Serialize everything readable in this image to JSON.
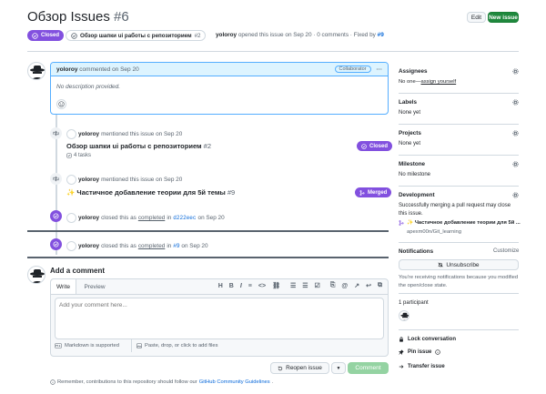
{
  "header": {
    "title": "Обзор Issues",
    "number": "#6",
    "edit_label": "Edit",
    "new_issue_label": "New issue"
  },
  "meta": {
    "status": "Closed",
    "linked_title": "Обзор шапки ui работы с репозиторием",
    "linked_number": "#2",
    "author": "yoloroy",
    "opened_text": "opened this issue on Sep 20 · 0 comments · Fixed by",
    "fixed_by": "#9"
  },
  "comment": {
    "author": "yoloroy",
    "action": "commented on Sep 20",
    "badge": "Collaborator",
    "body": "No description provided."
  },
  "timeline": {
    "mention1": {
      "author": "yoloroy",
      "action": "mentioned this issue on Sep 20",
      "title": "Обзор шапки ui работы с репозиторием",
      "number": "#2",
      "tasks": "4 tasks",
      "status": "Closed"
    },
    "mention2": {
      "author": "yoloroy",
      "action": "mentioned this issue on Sep 20",
      "title": "✨ Частичное добавление теории для 5й темы",
      "number": "#9",
      "status": "Merged"
    },
    "closed1": {
      "author": "yoloroy",
      "pre": "closed this as",
      "state": "completed",
      "mid": "in",
      "commit": "d222eec",
      "date": "on Sep 20"
    },
    "closed2": {
      "author": "yoloroy",
      "pre": "closed this as",
      "state": "completed",
      "mid": "in",
      "ref": "#9",
      "date": "on Sep 20"
    }
  },
  "add_comment": {
    "heading": "Add a comment",
    "tab_write": "Write",
    "tab_preview": "Preview",
    "placeholder": "Add your comment here...",
    "markdown_note": "Markdown is supported",
    "attach_note": "Paste, drop, or click to add files",
    "reopen_label": "Reopen issue",
    "comment_label": "Comment",
    "footer_pre": "Remember, contributions to this repository should follow our",
    "footer_link": "GitHub Community Guidelines",
    "footer_post": "."
  },
  "sidebar": {
    "assignees_h": "Assignees",
    "assignees_v_pre": "No one—",
    "assignees_v_link": "assign yourself",
    "labels_h": "Labels",
    "labels_v": "None yet",
    "projects_h": "Projects",
    "projects_v": "None yet",
    "milestone_h": "Milestone",
    "milestone_v": "No milestone",
    "development_h": "Development",
    "development_note": "Successfully merging a pull request may close this issue.",
    "dev_pr_title": "✨ Частичное добавление теории для 5й ...",
    "dev_pr_repo": "apexm00n/Git_learning",
    "notifications_h": "Notifications",
    "customize": "Customize",
    "unsubscribe": "Unsubscribe",
    "notif_note": "You're receiving notifications because you modified the open/close state.",
    "participants": "1 participant",
    "lock": "Lock conversation",
    "pin": "Pin issue",
    "transfer": "Transfer issue"
  },
  "colors": {
    "purple": "#8250df",
    "green": "#1f883d",
    "blue": "#0969da"
  }
}
